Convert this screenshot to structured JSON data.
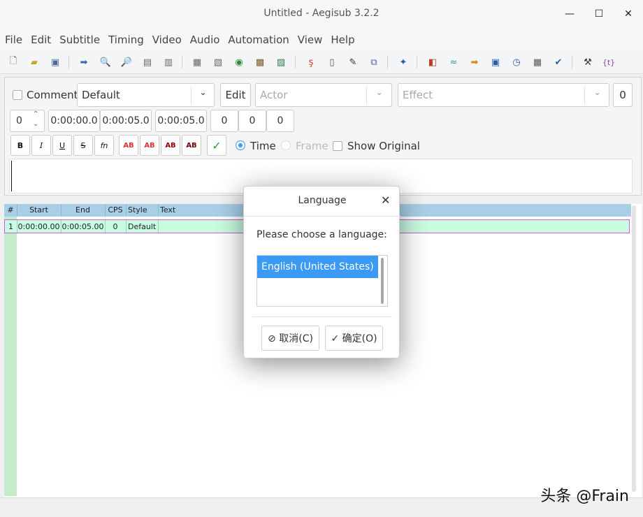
{
  "window": {
    "title": "Untitled - Aegisub 3.2.2",
    "minimize": "—",
    "maximize": "☐",
    "close": "✕"
  },
  "menu": [
    "File",
    "Edit",
    "Subtitle",
    "Timing",
    "Video",
    "Audio",
    "Automation",
    "View",
    "Help"
  ],
  "edit": {
    "comment_label": "Comment",
    "style_value": "Default",
    "edit_button": "Edit",
    "actor_placeholder": "Actor",
    "effect_placeholder": "Effect",
    "margin_layer": "0",
    "layer": "0",
    "start_time": "0:00:00.0",
    "end_time": "0:00:05.0",
    "duration": "0:00:05.0",
    "margin_left": "0",
    "margin_right": "0",
    "margin_vertical": "0",
    "bold": "B",
    "italic": "I",
    "underline": "U",
    "strike": "S",
    "font": "fn",
    "color1": "AB",
    "color2": "AB",
    "color3": "AB",
    "color4": "AB",
    "commit": "✓",
    "time_label": "Time",
    "frame_label": "Frame",
    "show_original_label": "Show Original"
  },
  "grid": {
    "headers": [
      "#",
      "Start",
      "End",
      "CPS",
      "Style",
      "Text"
    ],
    "rows": [
      {
        "num": "1",
        "start": "0:00:00.00",
        "end": "0:00:05.00",
        "cps": "0",
        "style": "Default",
        "text": ""
      }
    ]
  },
  "dialog": {
    "title": "Language",
    "close": "✕",
    "prompt": "Please choose a language:",
    "options": [
      "English (United States)"
    ],
    "cancel": "⊘ 取消(C)",
    "ok": "✓ 确定(O)"
  },
  "watermark": "头条 @Frain",
  "colors": {
    "accent": "#3b9af3",
    "grid_header": "#a8cfe6",
    "row_bg": "#c8fbe0",
    "row_border": "#d05ad8",
    "gutter": "#c5ecca"
  }
}
